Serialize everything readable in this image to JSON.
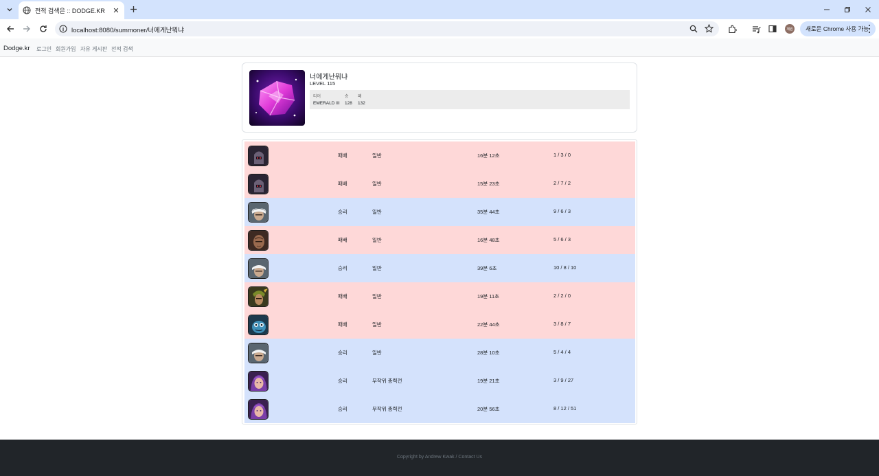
{
  "browser": {
    "tab_title": "전적 검색은 :: DODGE.KR",
    "url": "localhost:8080/summoner/너에게난뭐냐",
    "profile_initials": "재원",
    "chrome_chip_label": "새로운 Chrome 사용 가능"
  },
  "navbar": {
    "brand": "Dodge.kr",
    "links": [
      "로그인",
      "회원가입",
      "자유 게시판",
      "전적 검색"
    ]
  },
  "profile": {
    "name": "너에게난뭐냐",
    "level": "LEVEL 115",
    "rank_headers": {
      "tier": "티어",
      "wins": "승",
      "losses": "패"
    },
    "tier": "EMERALD III",
    "wins": "128",
    "losses": "132"
  },
  "colors": {
    "loss_row": "#fed8d8",
    "win_row": "#d4e2fc",
    "footer_bg": "#212529"
  },
  "matches": [
    {
      "result": "패배",
      "mode": "일반",
      "duration": "16분 12초",
      "kda": "1 / 3 / 0",
      "outcome": "loss",
      "champion_icon": "dark-armored-champion"
    },
    {
      "result": "패배",
      "mode": "일반",
      "duration": "15분 23초",
      "kda": "2 / 7 / 2",
      "outcome": "loss",
      "champion_icon": "dark-armored-champion"
    },
    {
      "result": "승리",
      "mode": "일반",
      "duration": "35분 44초",
      "kda": "9 / 6 / 3",
      "outcome": "win",
      "champion_icon": "white-haired-champion"
    },
    {
      "result": "패배",
      "mode": "일반",
      "duration": "16분 48초",
      "kda": "5 / 6 / 3",
      "outcome": "loss",
      "champion_icon": "bald-warrior-champion"
    },
    {
      "result": "승리",
      "mode": "일반",
      "duration": "39분 6초",
      "kda": "10 / 8 / 10",
      "outcome": "win",
      "champion_icon": "white-haired-champion"
    },
    {
      "result": "패배",
      "mode": "일반",
      "duration": "19분 11초",
      "kda": "2 / 2 / 0",
      "outcome": "loss",
      "champion_icon": "green-archer-champion"
    },
    {
      "result": "패배",
      "mode": "일반",
      "duration": "22분 44초",
      "kda": "3 / 8 / 7",
      "outcome": "loss",
      "champion_icon": "blue-fish-champion"
    },
    {
      "result": "승리",
      "mode": "일반",
      "duration": "28분 10초",
      "kda": "5 / 4 / 4",
      "outcome": "win",
      "champion_icon": "white-haired-champion"
    },
    {
      "result": "승리",
      "mode": "무작위 총력전",
      "duration": "19분 21초",
      "kda": "3 / 9 / 27",
      "outcome": "win",
      "champion_icon": "purple-haired-champion"
    },
    {
      "result": "승리",
      "mode": "무작위 총력전",
      "duration": "20분 56초",
      "kda": "8 / 12 / 51",
      "outcome": "win",
      "champion_icon": "purple-haired-champion"
    }
  ],
  "footer": {
    "text": "Copyright by Andrew Kwak / Contact Us"
  }
}
